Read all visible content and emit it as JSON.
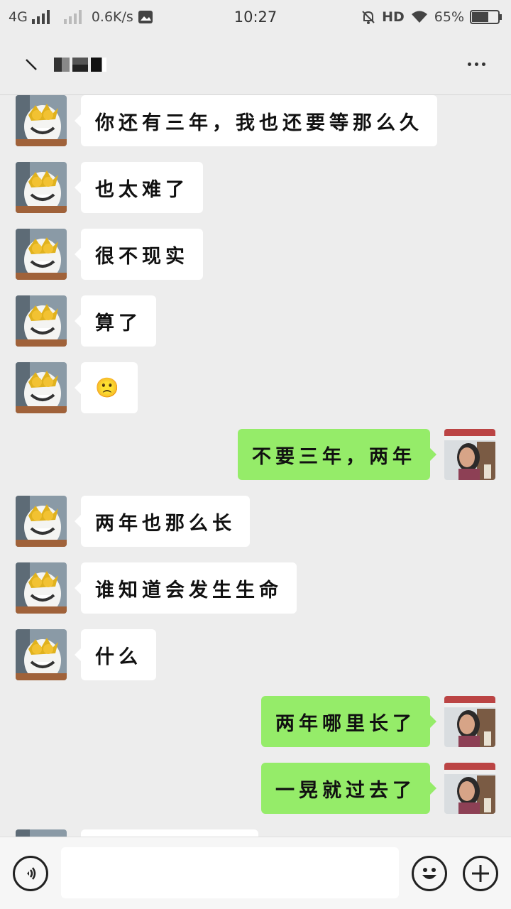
{
  "status_bar": {
    "network": "4G",
    "speed": "0.6K/s",
    "time": "10:27",
    "hd": "HD",
    "battery": "65%",
    "battery_level": 0.65
  },
  "header": {
    "title_masked": "■■■",
    "back_icon": "back-arrow-icon",
    "more_icon": "more-dots-icon"
  },
  "colors": {
    "background": "#ededed",
    "sent_bubble": "#95ec69",
    "received_bubble": "#ffffff"
  },
  "messages": [
    {
      "side": "left",
      "text": "你还有三年，我也还要等那么久"
    },
    {
      "side": "left",
      "text": "也太难了"
    },
    {
      "side": "left",
      "text": "很不现实"
    },
    {
      "side": "left",
      "text": "算了"
    },
    {
      "side": "left",
      "text": "🙁"
    },
    {
      "side": "right",
      "text": "不要三年，两年"
    },
    {
      "side": "left",
      "text": "两年也那么长"
    },
    {
      "side": "left",
      "text": "谁知道会发生生命"
    },
    {
      "side": "left",
      "text": "什么"
    },
    {
      "side": "right",
      "text": "两年哪里长了"
    },
    {
      "side": "right",
      "text": "一晃就过去了"
    }
  ],
  "input": {
    "placeholder": "",
    "value": ""
  }
}
